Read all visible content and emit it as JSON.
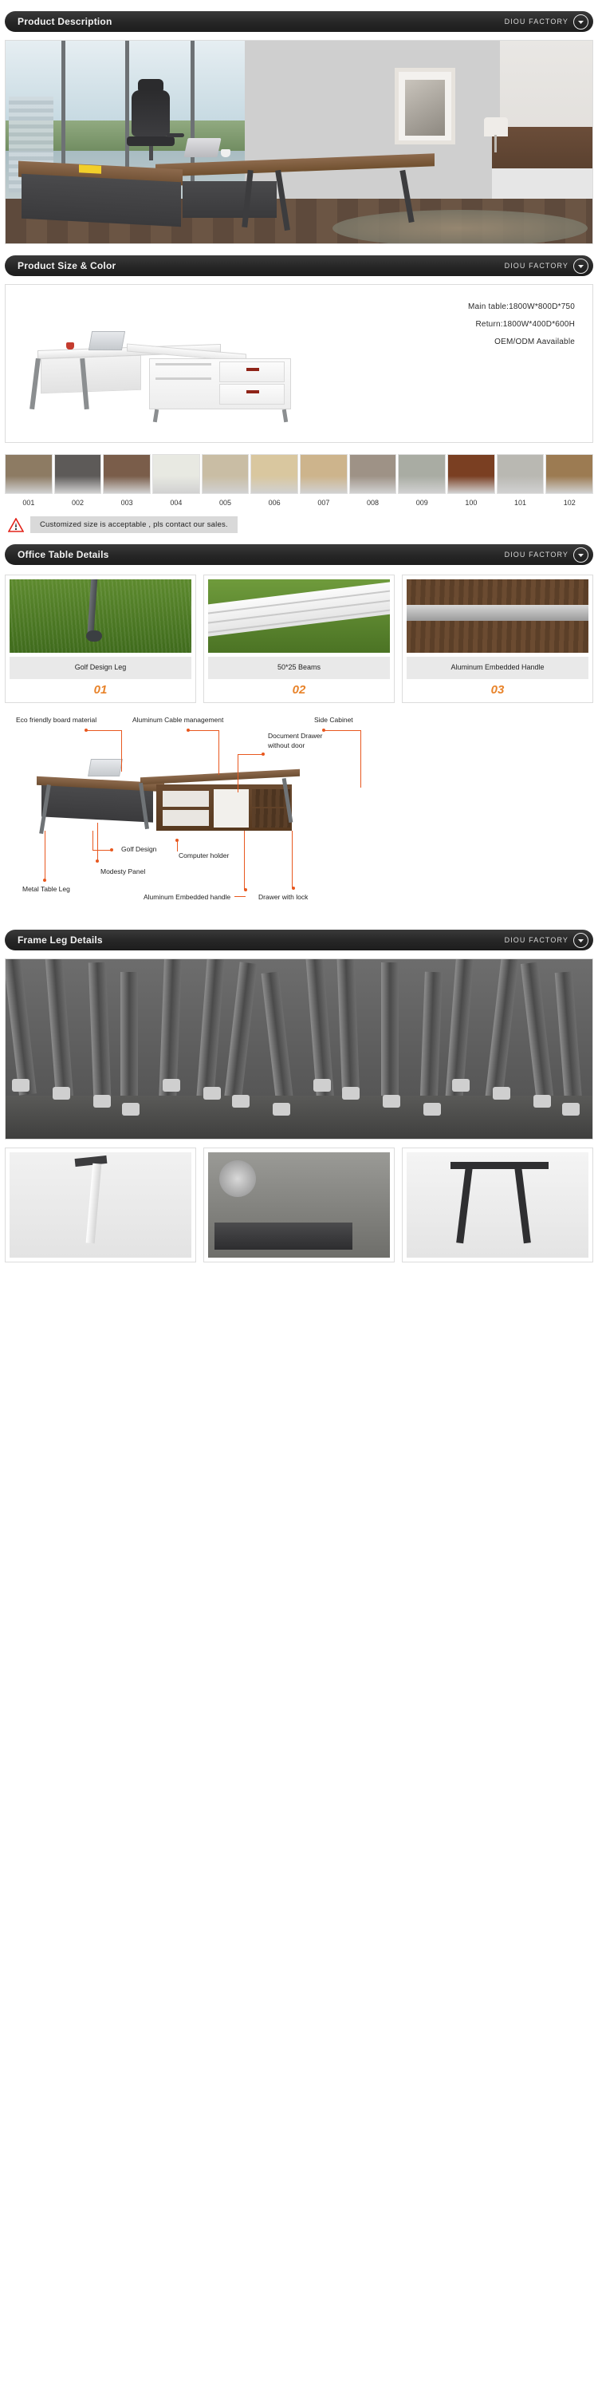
{
  "brand": "DIOU FACTORY",
  "sections": {
    "description": {
      "title": "Product Description"
    },
    "size_color": {
      "title": "Product Size & Color"
    },
    "table_details": {
      "title": "Office Table Details"
    },
    "frame_leg": {
      "title": "Frame Leg Details"
    }
  },
  "specs": {
    "main_table": "Main table:1800W*800D*750",
    "return": "Return:1800W*400D*600H",
    "oem": "OEM/ODM Aavailable"
  },
  "colors": {
    "swatches": [
      {
        "code": "001",
        "hex": "#8d7b63"
      },
      {
        "code": "002",
        "hex": "#5d5a58"
      },
      {
        "code": "003",
        "hex": "#7a5d4a"
      },
      {
        "code": "004",
        "hex": "#e8e9e2"
      },
      {
        "code": "005",
        "hex": "#c9bda4"
      },
      {
        "code": "006",
        "hex": "#d9c79f"
      },
      {
        "code": "007",
        "hex": "#cdb48c"
      },
      {
        "code": "008",
        "hex": "#9e9286"
      },
      {
        "code": "009",
        "hex": "#a9aca3"
      },
      {
        "code": "100",
        "hex": "#7a3f22"
      },
      {
        "code": "101",
        "hex": "#b9b8b2"
      },
      {
        "code": "102",
        "hex": "#9c7b52"
      }
    ]
  },
  "note": {
    "icon": "warning-triangle-icon",
    "text": "Customized size is acceptable , pls contact our sales."
  },
  "detail_cards": [
    {
      "caption": "Golf Design Leg",
      "number": "01",
      "art": "golf-leg-photo"
    },
    {
      "caption": "50*25 Beams",
      "number": "02",
      "art": "beams-photo"
    },
    {
      "caption": "Aluminum Embedded Handle",
      "number": "03",
      "art": "handle-photo"
    }
  ],
  "diagram": {
    "labels": [
      {
        "id": "eco-board",
        "text": "Eco friendly board material"
      },
      {
        "id": "cable-mgmt",
        "text": "Aluminum Cable management"
      },
      {
        "id": "side-cabinet",
        "text": "Side Cabinet"
      },
      {
        "id": "document-drawer-1",
        "text": "Document Drawer"
      },
      {
        "id": "document-drawer-2",
        "text": "without door"
      },
      {
        "id": "golf-design",
        "text": "Golf Design"
      },
      {
        "id": "computer-holder",
        "text": "Computer holder"
      },
      {
        "id": "modesty-panel",
        "text": "Modesty Panel"
      },
      {
        "id": "metal-table-leg",
        "text": "Metal Table Leg"
      },
      {
        "id": "aluminum-handle",
        "text": "Aluminum Embedded handle"
      },
      {
        "id": "drawer-with-lock",
        "text": "Drawer with lock"
      }
    ]
  },
  "accent": {
    "orange": "#e8581f",
    "number_orange": "#e8832a",
    "bar_dark": "#262626"
  }
}
